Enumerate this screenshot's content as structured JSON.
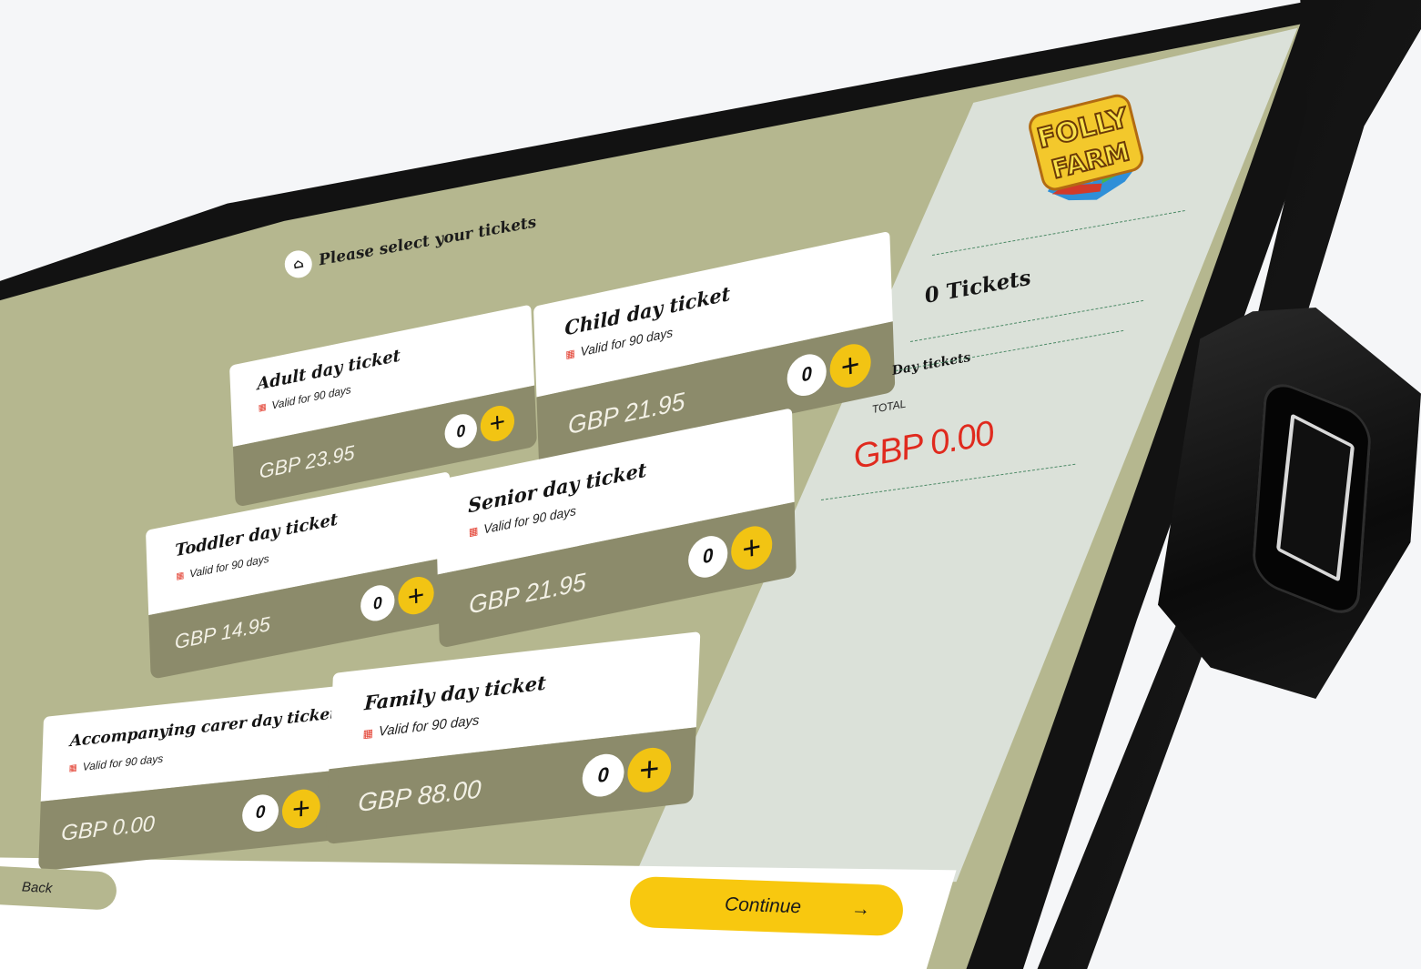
{
  "header": {
    "title": "Please select your tickets",
    "home_icon": "home-icon"
  },
  "tickets": [
    {
      "title": "Adult day ticket",
      "validity": "Valid for 90 days",
      "price": "GBP 23.95",
      "count": "0",
      "plus": "+"
    },
    {
      "title": "Child day ticket",
      "validity": "Valid for 90 days",
      "price": "GBP 21.95",
      "count": "0",
      "plus": "+"
    },
    {
      "title": "Toddler day ticket",
      "validity": "Valid for 90 days",
      "price": "GBP 14.95",
      "count": "0",
      "plus": "+"
    },
    {
      "title": "Senior day ticket",
      "validity": "Valid for 90 days",
      "price": "GBP 21.95",
      "count": "0",
      "plus": "+"
    },
    {
      "title": "Accompanying carer day ticket",
      "validity": "Valid for 90 days",
      "price": "GBP 0.00",
      "count": "0",
      "plus": "+"
    },
    {
      "title": "Family day ticket",
      "validity": "Valid for 90 days",
      "price": "GBP 88.00",
      "count": "0",
      "plus": "+"
    }
  ],
  "summary": {
    "logo_line1": "FOLLY",
    "logo_line2": "FARM",
    "tickets_count": "0 Tickets",
    "section": "Day tickets",
    "total_label": "TOTAL",
    "total_value": "GBP 0.00"
  },
  "footer": {
    "back_label": "Back",
    "continue_label": "Continue",
    "continue_arrow": "→"
  },
  "colors": {
    "panel_green": "#b5b78f",
    "card_olive": "#8c8b6b",
    "accent_yellow": "#f8c80f",
    "total_red": "#e02a1e",
    "summary_bg": "#dbe1d9"
  }
}
